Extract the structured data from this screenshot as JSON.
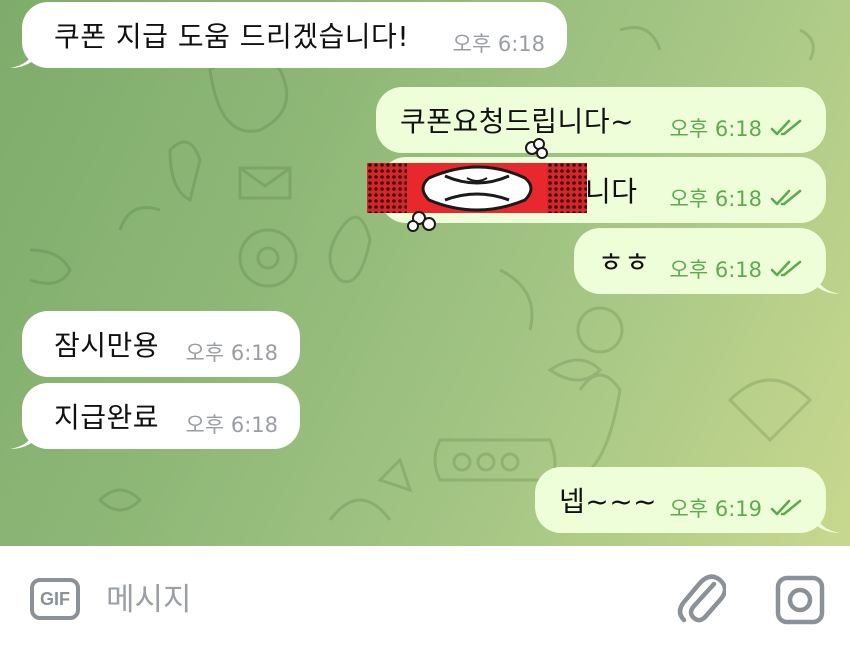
{
  "messages": [
    {
      "text": "쿠폰 지급 도움 드리겠습니다!",
      "time": "오후 6:18",
      "direction": "in"
    },
    {
      "text": "쿠폰요청드립니다~",
      "time": "오후 6:18",
      "direction": "out"
    },
    {
      "text": "니다",
      "time": "오후 6:18",
      "direction": "out"
    },
    {
      "text": "ㅎㅎ",
      "time": "오후 6:18",
      "direction": "out"
    },
    {
      "text": "잠시만용",
      "time": "오후 6:18",
      "direction": "in"
    },
    {
      "text": "지급완료",
      "time": "오후 6:18",
      "direction": "in"
    },
    {
      "text": "넵~~~",
      "time": "오후 6:19",
      "direction": "out"
    }
  ],
  "input": {
    "gif_label": "GIF",
    "placeholder": "메시지"
  },
  "colors": {
    "incoming_bubble": "#ffffff",
    "outgoing_bubble": "#eefed8",
    "outgoing_meta": "#5dab4f",
    "incoming_meta": "#9a9ea3"
  },
  "icons": [
    "gif-icon",
    "paperclip-icon",
    "camera-icon",
    "double-check-icon",
    "angry-face-sticker"
  ]
}
